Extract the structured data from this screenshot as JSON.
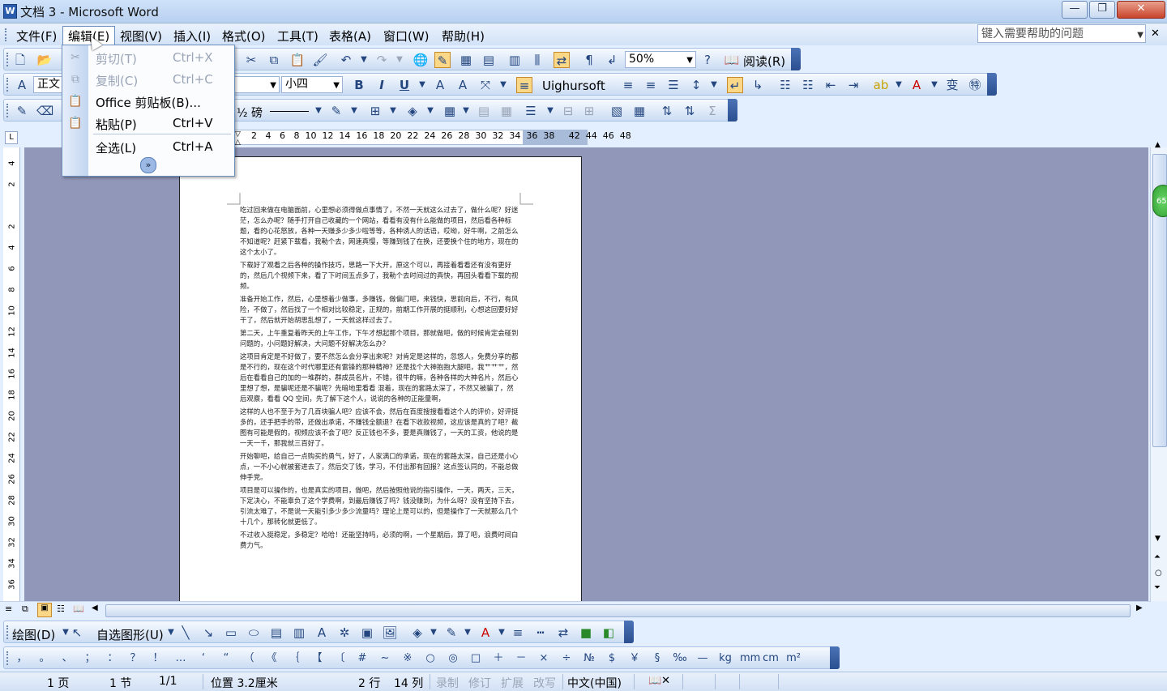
{
  "window": {
    "title": "文档 3 - Microsoft Word",
    "app_icon": "W",
    "min": "—",
    "max": "❐",
    "close": "✕"
  },
  "menubar": {
    "items": [
      "文件(F)",
      "编辑(E)",
      "视图(V)",
      "插入(I)",
      "格式(O)",
      "工具(T)",
      "表格(A)",
      "窗口(W)",
      "帮助(H)"
    ],
    "help_placeholder": "键入需要帮助的问题"
  },
  "toolbar_standard": {
    "zoom": "50%",
    "read": "阅读(R)"
  },
  "toolbar_format": {
    "style": "正文",
    "size": "小四",
    "font": "Uighursoft",
    "bold": "B",
    "italic": "I",
    "underline": "U"
  },
  "toolbar_tables": {
    "line_weight": "½ 磅"
  },
  "ruler": {
    "numbers": "2   4   6   8  10  12  14  16  18  20  22  24  26  28  30  32  34  36  38     42  44  46  48",
    "corner": "L"
  },
  "vruler": [
    "4",
    "2",
    "",
    "2",
    "4",
    "6",
    "8",
    "10",
    "12",
    "14",
    "16",
    "18",
    "20",
    "22",
    "24",
    "26",
    "28",
    "30",
    "32",
    "34",
    "36"
  ],
  "edit_menu": {
    "items": [
      {
        "label": "剪切(T)",
        "shortcut": "Ctrl+X",
        "disabled": true,
        "icon": "scissors-icon"
      },
      {
        "label": "复制(C)",
        "shortcut": "Ctrl+C",
        "disabled": true,
        "icon": "copy-icon"
      },
      {
        "label": "Office 剪贴板(B)...",
        "shortcut": "",
        "disabled": false,
        "icon": "clipboard-icon"
      },
      {
        "label": "粘贴(P)",
        "shortcut": "Ctrl+V",
        "disabled": false,
        "icon": "paste-icon"
      },
      {
        "label": "全选(L)",
        "shortcut": "Ctrl+A",
        "disabled": false,
        "icon": ""
      }
    ],
    "more": "»"
  },
  "document": {
    "paragraphs": [
      "吃过回来做在电脑面前，心里想必须得做点事情了，不然一天就这么过去了，做什么呢？好迷茫，怎么办呢？随手打开自己收藏的一个网站，看看有没有什么能做的项目，然后看各种标题，看的心花怒放，各种一天赚多少多少啦等等，各种诱人的话语，哎呦，好牛啊，之前怎么不知道呢？赶紧下载看，我勒个去，网速真慢，等赚到钱了在换，还要换个住的地方，现在的这个太小了。",
      "下载好了观看之后各种的操作技巧，思路一下大开，原这个可以，再接着看看还有没有更好的，然后几个视频下来，看了下时间五点多了，我勒个去时间过的真快，再回头看看下载的视频。",
      "准备开始工作，然后，心里想着少做事，多赚钱，做偏门吧，来钱快，思前向后，不行，有风险，不做了，然后找了一个相对比较稳定，正规的，前期工作开展的挺顺利，心想这回要好好干了，然后就开始胡思乱想了，一天就这样过去了。",
      "第二天，上午重复着昨天的上午工作，下午才想起那个项目，那就做吧，做的时候肯定会碰到问题的，小问题好解决，大问题不好解决怎么办？",
      "这项目肯定是不好做了，要不然怎么会分享出来呢？对肯定是这样的，忽悠人，免费分享的都是不行的，现在这个时代哪里还有雷锋的那种精神？还是找个大神抱抱大腿吧，我艹艹艹，然后在看看自己的加的一堆群的，群成员名片，不错，很牛的嘛，各种各样的大神名片，然后心里想了想，是骗呢还是不骗呢？先暗地里看看 混着，现在的套路太深了，不然又被骗了，然后观察，看看 QQ 空间，先了解下这个人，说说的各种的正能量啊，",
      "这样的人也不至于为了几百块骗人吧？应该不会，然后在百度搜搜看看这个人的评价，好评挺多的，还手把手的带，还做出承诺，不赚钱全额退？在看下收款视频，这应该是真的了吧？截图有可能是假的，视频应该不会了吧？反正钱也不多，要是真赚钱了，一天的工资，他说的是一天一千，那我就三百好了。",
      "开始聊吧，给自己一点购买的勇气，好了，人家满口的承诺，现在的套路太深，自己还是小心点，一不小心就被套进去了，然后交了钱，学习，不付出那有回报？这点签认同的，不能总做伸手党。",
      "项目是可以操作的，也是真实的项目，做吧，然后按照他说的指引操作，一天，两天，三天，下定决心，不能辜负了这个学费啊，到最后赚钱了吗？钱没赚到，为什么呀？没有坚持下去，引流太难了，不是说一天能引多少多少流量吗？理论上是可以的，但是操作了一天就那么几个十几个，那转化就更低了。",
      "不过收入挺稳定，多稳定？哈哈！还能坚持吗，必须的啊，一个星期后，算了吧，浪费时间白费力气。"
    ]
  },
  "drawing_toolbar": {
    "draw": "绘图(D)",
    "autoshapes": "自选图形(U)"
  },
  "symbol_toolbar": {
    "symbols": [
      "，",
      "。",
      "、",
      "；",
      "：",
      "？",
      "！",
      "…",
      "‘",
      "“",
      "（",
      "《",
      "｛",
      "【",
      "〔",
      "#",
      "~",
      "※",
      "○",
      "◎",
      "□",
      "＋",
      "－",
      "×",
      "÷",
      "№",
      "$",
      "￥",
      "§",
      "‰",
      "—",
      "kg",
      "mm",
      "cm",
      "m²"
    ]
  },
  "statusbar": {
    "page": "1 页",
    "section": "1 节",
    "pages": "1/1",
    "position": "位置 3.2厘米",
    "line": "2 行",
    "col": "14 列",
    "rec": "录制",
    "trk": "修订",
    "ext": "扩展",
    "ovr": "改写",
    "lang": "中文(中国)"
  },
  "green_badge": "65"
}
